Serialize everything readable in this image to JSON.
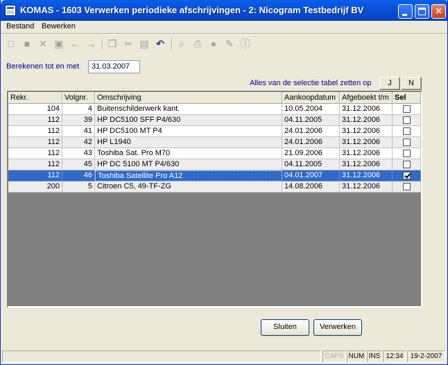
{
  "window": {
    "title": "KOMAS - 1603 Verwerken periodieke afschrijvingen - 2: Nicogram Testbedrijf BV"
  },
  "menu": {
    "items": [
      {
        "label": "Bestand"
      },
      {
        "label": "Bewerken"
      }
    ]
  },
  "toolbar": {
    "icons": [
      "new-icon",
      "save-icon",
      "delete-icon",
      "save-as-icon",
      "arrow-left-icon",
      "arrow-right-icon",
      "copy-icon",
      "cut-icon",
      "paste-icon",
      "undo-icon",
      "find-icon",
      "print-icon",
      "bell-icon",
      "edit-icon",
      "info-icon"
    ]
  },
  "form": {
    "bereken_label": "Berekenen tot en met",
    "bereken_value": "31.03.2007",
    "alles_label": "Alles van de selectie tabel zetten op",
    "j_label": "J",
    "n_label": "N"
  },
  "table": {
    "headers": [
      "Rekr.",
      "Volgnr.",
      "Omschrijving",
      "Aankoopdatum",
      "Afgeboekt t/m",
      "Sel"
    ],
    "rows": [
      {
        "rekr": "104",
        "volgnr": "4",
        "omschrijving": "Buitenschilderwerk kant.",
        "aankoopdatum": "10.05.2004",
        "afgeboekt": "31.12.2006",
        "sel": false
      },
      {
        "rekr": "112",
        "volgnr": "39",
        "omschrijving": "HP DC5100 SFF P4/630",
        "aankoopdatum": "04.11.2005",
        "afgeboekt": "31.12.2006",
        "sel": false
      },
      {
        "rekr": "112",
        "volgnr": "41",
        "omschrijving": "HP DC5100 MT P4",
        "aankoopdatum": "24.01.2006",
        "afgeboekt": "31.12.2006",
        "sel": false
      },
      {
        "rekr": "112",
        "volgnr": "42",
        "omschrijving": "HP L1940",
        "aankoopdatum": "24.01.2006",
        "afgeboekt": "31.12.2006",
        "sel": false
      },
      {
        "rekr": "112",
        "volgnr": "43",
        "omschrijving": "Toshiba Sat. Pro M70",
        "aankoopdatum": "21.09.2006",
        "afgeboekt": "31.12.2006",
        "sel": false
      },
      {
        "rekr": "112",
        "volgnr": "45",
        "omschrijving": "HP DC 5100 MT P4/630",
        "aankoopdatum": "04.11.2005",
        "afgeboekt": "31.12.2006",
        "sel": false
      },
      {
        "rekr": "112",
        "volgnr": "46",
        "omschrijving": "Toshiba Satellite Pro A12",
        "aankoopdatum": "04.01.2007",
        "afgeboekt": "31.12.2006",
        "sel": true
      },
      {
        "rekr": "200",
        "volgnr": "5",
        "omschrijving": "Citroen C5, 49-TF-ZG",
        "aankoopdatum": "14.08.2006",
        "afgeboekt": "31.12.2006",
        "sel": false
      }
    ],
    "selected_row": 6
  },
  "buttons": {
    "sluiten": "Sluiten",
    "verwerken": "Verwerken"
  },
  "status": {
    "caps": "CAPS",
    "num": "NUM",
    "ins": "INS",
    "time": "12:34",
    "date": "19-2-2007"
  }
}
